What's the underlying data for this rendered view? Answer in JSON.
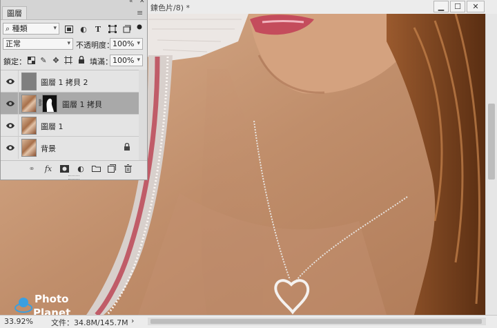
{
  "document": {
    "title_fragment": "鍊色片/8) *",
    "zoom": "33.92%",
    "file_info": "文件：34.8M/145.7M",
    "status_arrow": "›",
    "window_controls": [
      "minimize-icon",
      "maximize-icon",
      "close-icon"
    ]
  },
  "watermark": {
    "line1": "Photo",
    "line2": "Planet"
  },
  "layers_panel": {
    "tab_label": "圖層",
    "collapse_glyph": "«",
    "close_glyph": "✕",
    "kind_filter": {
      "value": "種類",
      "icons": [
        "search-icon"
      ]
    },
    "filter_icons": [
      "image-filter-icon",
      "adjustment-filter-icon",
      "type-filter-icon",
      "shape-filter-icon",
      "smart-object-filter-icon",
      "filter-toggle-icon"
    ],
    "blend_mode": "正常",
    "opacity_label": "不透明度：",
    "opacity_value": "100%",
    "lock_label": "鎖定：",
    "lock_icons": [
      "lock-transparent-icon",
      "lock-paint-icon",
      "lock-move-icon",
      "lock-artboard-icon",
      "lock-all-icon"
    ],
    "fill_label": "填滿：",
    "fill_value": "100%",
    "layers": [
      {
        "name": "圖層 1 拷貝 2",
        "thumb": "gray",
        "selected": false,
        "locked": false,
        "has_mask": false
      },
      {
        "name": "圖層 1 拷貝",
        "thumb": "photo",
        "selected": true,
        "locked": false,
        "has_mask": true
      },
      {
        "name": "圖層 1",
        "thumb": "photo",
        "selected": false,
        "locked": false,
        "has_mask": false
      },
      {
        "name": "背景",
        "thumb": "photo",
        "selected": false,
        "locked": true,
        "has_mask": false
      }
    ],
    "footer_icons": [
      "link-layers-icon",
      "fx-icon",
      "add-mask-icon",
      "adjustment-layer-icon",
      "new-group-icon",
      "new-layer-icon",
      "trash-icon"
    ],
    "fx_label": "fx"
  }
}
